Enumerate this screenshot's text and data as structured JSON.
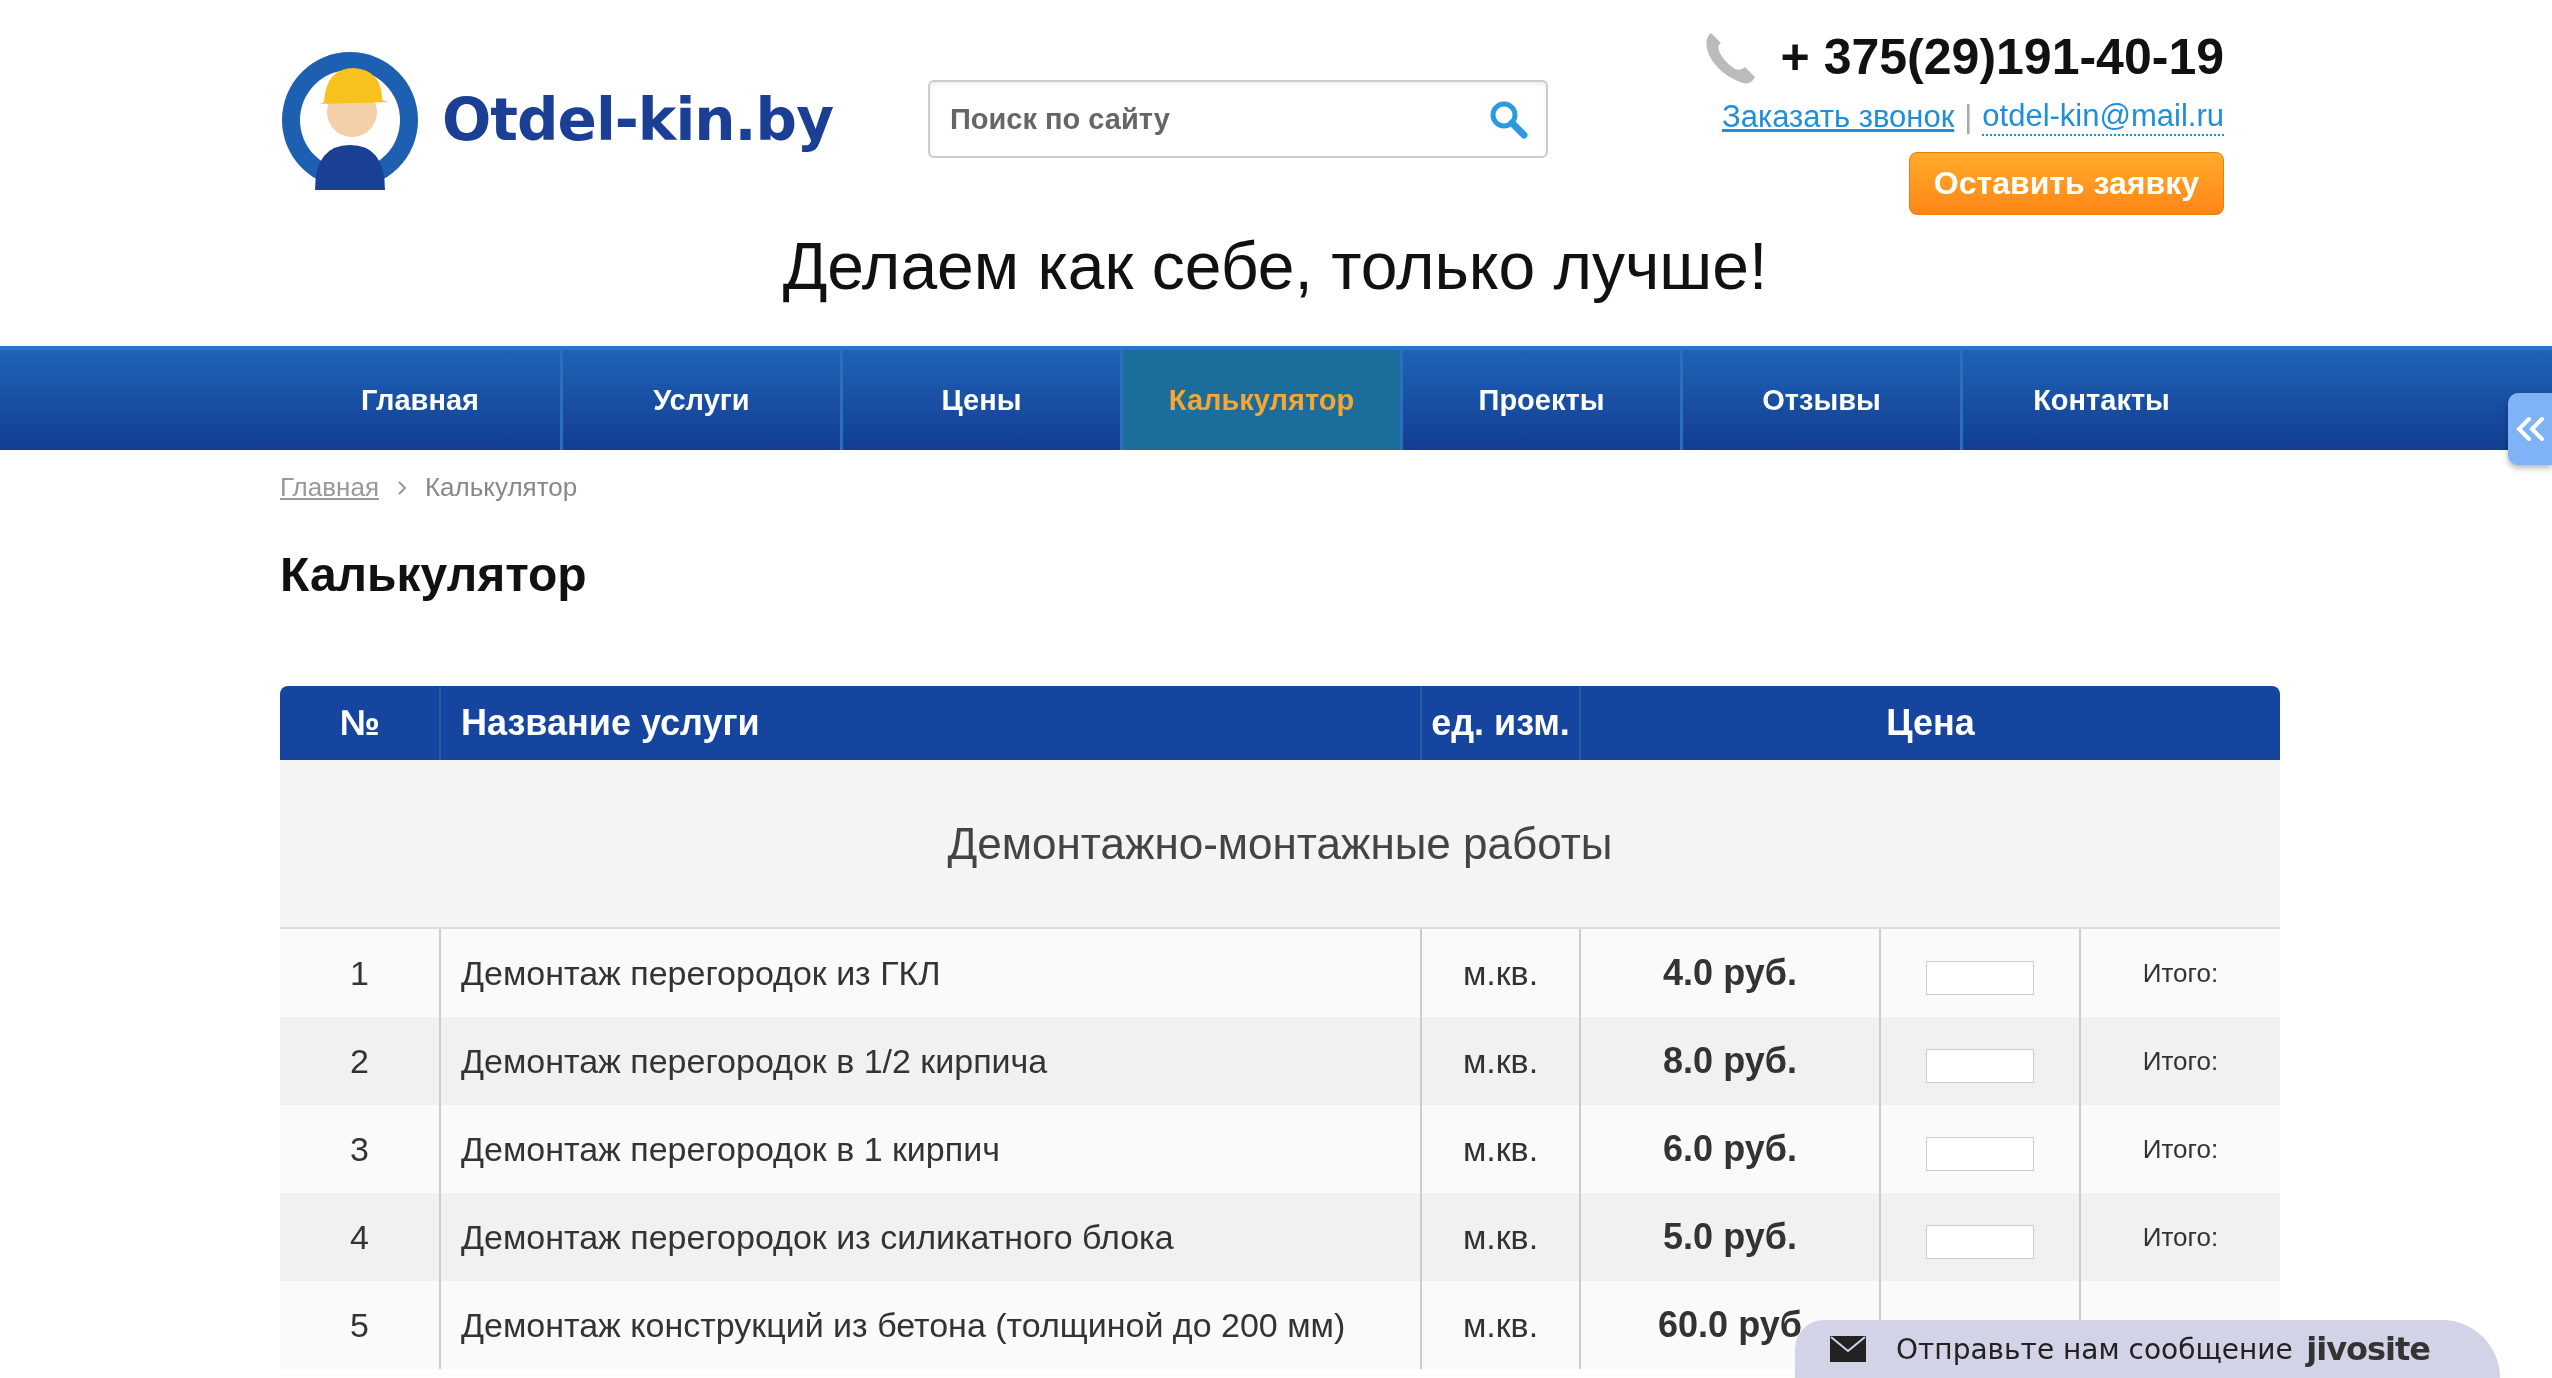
{
  "header": {
    "logo_text": "Otdel-kin.by",
    "search": {
      "placeholder": "Поиск по сайту"
    },
    "phone": "+ 375(29)191-40-19",
    "callback_link": "Заказать звонок",
    "separator": "|",
    "email": "otdel-kin@mail.ru",
    "request_button": "Оставить заявку",
    "slogan": "Делаем как себе, только лучше!"
  },
  "nav": [
    {
      "label": "Главная",
      "selected": false
    },
    {
      "label": "Услуги",
      "selected": false
    },
    {
      "label": "Цены",
      "selected": false
    },
    {
      "label": "Калькулятор",
      "selected": true
    },
    {
      "label": "Проекты",
      "selected": false
    },
    {
      "label": "Отзывы",
      "selected": false
    },
    {
      "label": "Контакты",
      "selected": false
    }
  ],
  "breadcrumb": [
    {
      "label": "Главная",
      "kind": "link"
    },
    {
      "label": "Калькулятор",
      "kind": "current"
    }
  ],
  "page_title": "Калькулятор",
  "table": {
    "columns": [
      "№",
      "Название услуги",
      "ед. изм.",
      "Цена"
    ],
    "sections": [
      {
        "title": "Демонтажно-монтажные работы",
        "rows": [
          {
            "number": "1",
            "name": "Демонтаж перегородок из ГКЛ",
            "unit": "м.кв.",
            "price": "4.0 руб.",
            "total_label": "Итого:"
          },
          {
            "number": "2",
            "name": "Демонтаж перегородок в 1/2 кирпича",
            "unit": "м.кв.",
            "price": "8.0 руб.",
            "total_label": "Итого:"
          },
          {
            "number": "3",
            "name": "Демонтаж перегородок в 1 кирпич",
            "unit": "м.кв.",
            "price": "6.0 руб.",
            "total_label": "Итого:"
          },
          {
            "number": "4",
            "name": "Демонтаж перегородок из силикатного блока",
            "unit": "м.кв.",
            "price": "5.0 руб.",
            "total_label": "Итого:"
          },
          {
            "number": "5",
            "name": "Демонтаж конструкций из бетона (толщиной до 200 мм)",
            "unit": "м.кв.",
            "price": "60.0 руб"
          }
        ]
      }
    ]
  },
  "chat_widget": {
    "message": "Отправьте нам сообщение",
    "brand": "jivosite"
  }
}
